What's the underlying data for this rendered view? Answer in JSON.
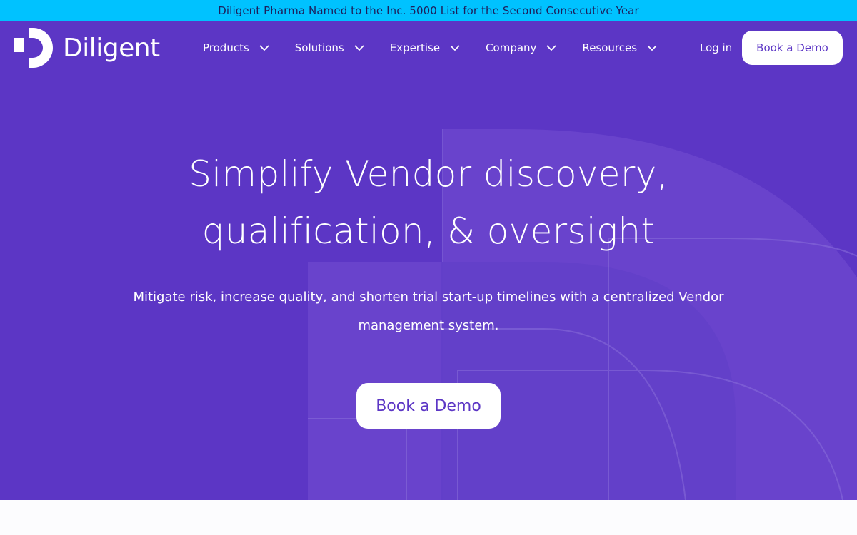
{
  "announcement": {
    "text": "Diligent Pharma Named to the Inc. 5000 List for the Second Consecutive Year"
  },
  "header": {
    "logo_text": "Diligent",
    "nav": [
      {
        "label": "Products"
      },
      {
        "label": "Solutions"
      },
      {
        "label": "Expertise"
      },
      {
        "label": "Company"
      },
      {
        "label": "Resources"
      }
    ],
    "login_label": "Log in",
    "demo_label": "Book a Demo"
  },
  "hero": {
    "headline_line1": "Simplify Vendor discovery,",
    "headline_line2": "qualification, & oversight",
    "subtext": "Mitigate risk, increase quality, and shorten trial start-up timelines with a centralized Vendor management system.",
    "cta_label": "Book a Demo"
  },
  "colors": {
    "announcement_bg": "#00c2ff",
    "hero_bg": "#5c36c5",
    "button_bg": "#ffffff",
    "button_text": "#5c36c5"
  }
}
